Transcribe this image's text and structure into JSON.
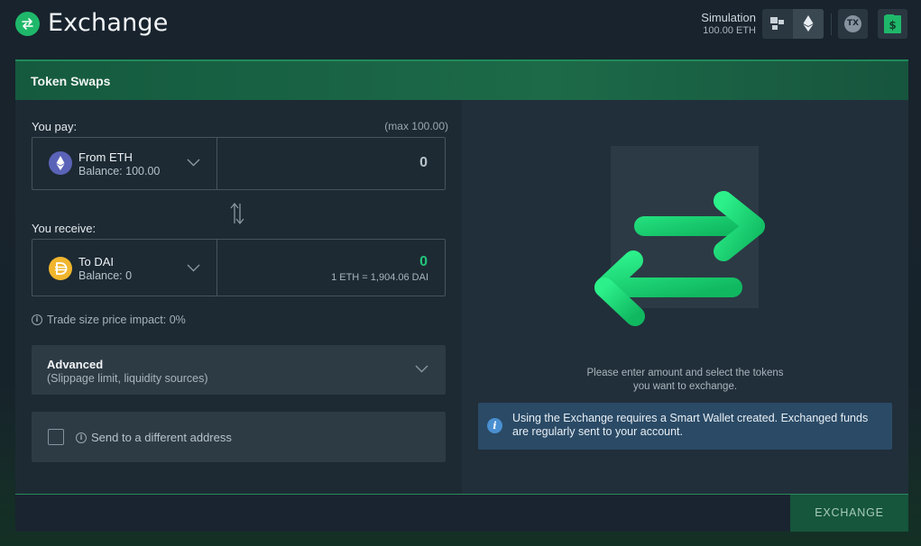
{
  "header": {
    "title": "Exchange",
    "simulation_label": "Simulation",
    "simulation_value": "100.00 ETH",
    "tx_label": "TX",
    "wallet_glyph": "$"
  },
  "panel": {
    "title": "Token Swaps",
    "you_pay_label": "You pay:",
    "max_label": "(max 100.00)",
    "from": {
      "name": "From ETH",
      "balance": "Balance: 100.00",
      "amount": "0",
      "icon": "eth-icon"
    },
    "you_receive_label": "You receive:",
    "to": {
      "name": "To DAI",
      "balance": "Balance: 0",
      "amount": "0",
      "rate": "1 ETH = 1,904.06 DAI",
      "icon": "dai-icon"
    },
    "impact_label": "Trade size price impact: 0%",
    "advanced_title": "Advanced",
    "advanced_sub": "(Slippage limit, liquidity sources)",
    "send_label": "Send to a different address",
    "hint": "Please enter amount and select the tokens you want to exchange.",
    "notice": "Using the Exchange requires a Smart Wallet created. Exchanged funds are regularly sent to your account.",
    "exchange_button": "EXCHANGE"
  },
  "colors": {
    "accent": "#1fb86a",
    "amount_green": "#22c57a",
    "header_green": "#1c6a48",
    "notice_blue": "#2a4a66"
  }
}
